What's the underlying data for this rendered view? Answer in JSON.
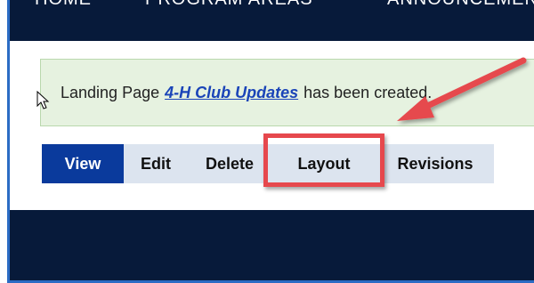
{
  "topnav": {
    "items": [
      "HOME",
      "PROGRAM AREAS",
      "ANNOUNCEMENTS"
    ]
  },
  "status": {
    "prefix": "Landing Page",
    "link_text": "4-H Club Updates",
    "suffix": "has been created."
  },
  "tabs": [
    {
      "label": "View",
      "active": true
    },
    {
      "label": "Edit",
      "active": false
    },
    {
      "label": "Delete",
      "active": false
    },
    {
      "label": "Layout",
      "active": false
    },
    {
      "label": "Revisions",
      "active": false
    }
  ],
  "annotation": {
    "color": "#e6484d",
    "target": "Layout"
  },
  "colors": {
    "nav_bg": "#071a3a",
    "active_tab": "#0a3a9c",
    "tab_bg": "#dce4ef",
    "status_bg": "#e6f2e0",
    "link": "#1a44b8"
  }
}
